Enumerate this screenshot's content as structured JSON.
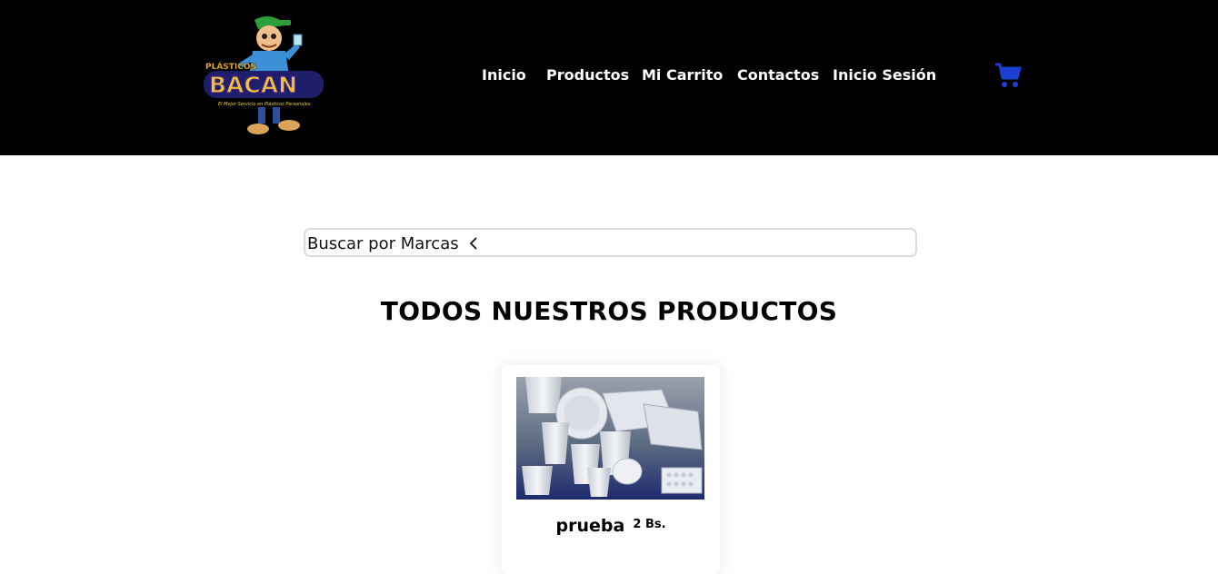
{
  "brand": {
    "logo_top": "PLÁSTICOS",
    "logo_name": "BACAN",
    "logo_tagline": "El Mejor Servicio en Plásticos Personales"
  },
  "nav": {
    "items": [
      {
        "label": "Inicio"
      },
      {
        "label": "Productos"
      },
      {
        "label": "Mi Carrito"
      },
      {
        "label": "Contactos"
      },
      {
        "label": "Inicio Sesión"
      }
    ],
    "cart_icon": "shopping-cart-icon"
  },
  "search": {
    "label": "Buscar por Marcas",
    "icon": "chevron-left-icon"
  },
  "main": {
    "title": "TODOS NUESTROS PRODUCTOS"
  },
  "products": [
    {
      "name": "prueba",
      "price": "2 Bs."
    }
  ],
  "colors": {
    "header_bg": "#000000",
    "cart_accent": "#1a3fd1",
    "text": "#000000"
  }
}
